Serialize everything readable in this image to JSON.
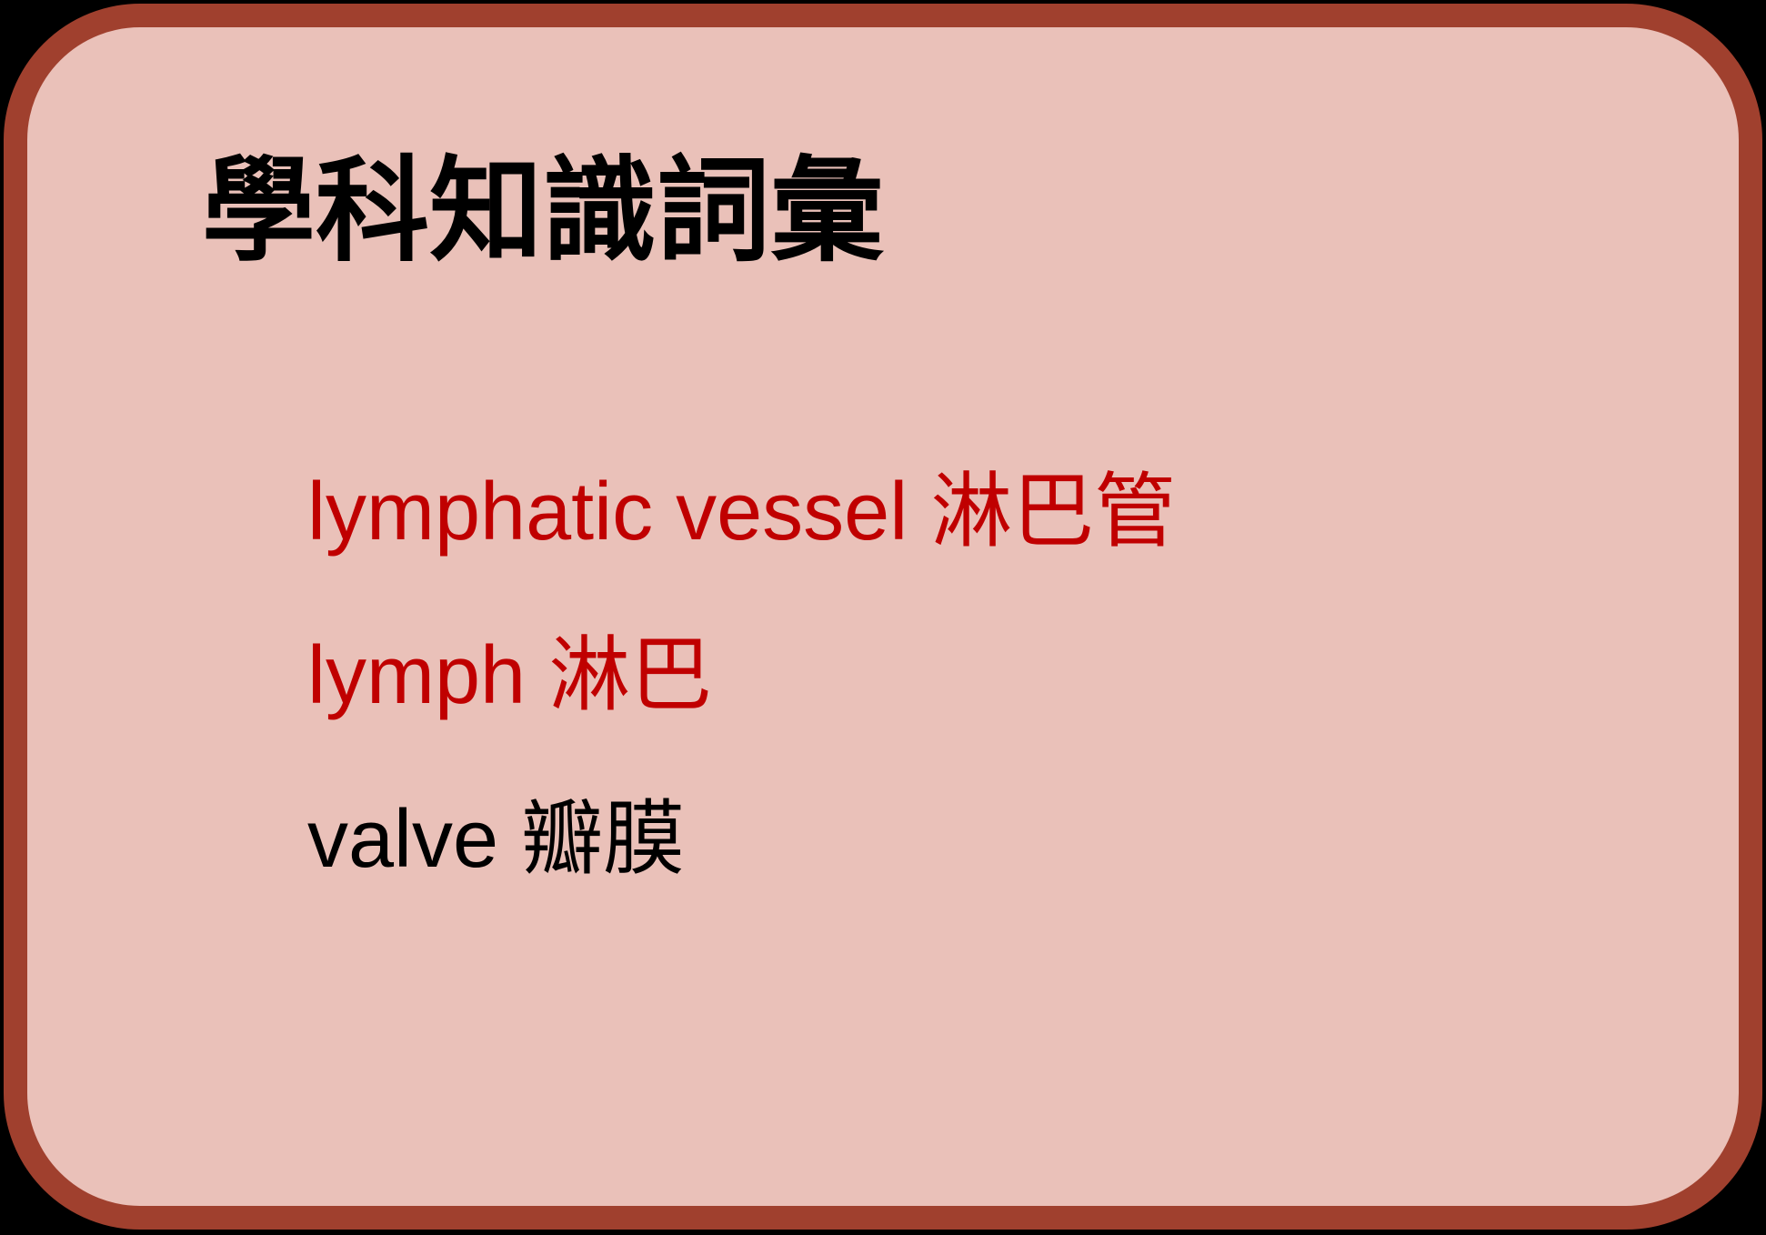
{
  "title": "學科知識詞彙",
  "terms": [
    {
      "text": "lymphatic vessel 淋巴管",
      "color": "#c00000"
    },
    {
      "text": "lymph 淋巴",
      "color": "#c00000"
    },
    {
      "text": "valve 瓣膜",
      "color": "#000000"
    }
  ],
  "colors": {
    "border": "#a0402e",
    "card_background": "#eac1b9",
    "outer_background": "#000000"
  }
}
